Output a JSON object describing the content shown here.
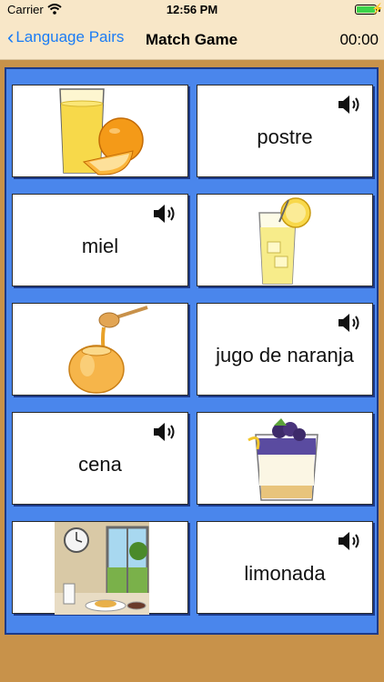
{
  "status": {
    "carrier": "Carrier",
    "time": "12:56 PM"
  },
  "nav": {
    "back_label": "Language Pairs",
    "title": "Match Game",
    "timer": "00:00"
  },
  "cards": {
    "r1_right": "postre",
    "r2_left": "miel",
    "r3_right": "jugo de naranja",
    "r4_left": "cena",
    "r5_right": "limonada"
  },
  "icons": {
    "speaker": "speaker-icon",
    "orange_juice": "orange-juice-icon",
    "lemonade": "lemonade-icon",
    "honey": "honey-icon",
    "dessert": "dessert-icon",
    "dinner": "dinner-scene-icon"
  },
  "colors": {
    "board": "#4a86ec",
    "accent": "#1a7cf5",
    "background": "#c8924a"
  }
}
